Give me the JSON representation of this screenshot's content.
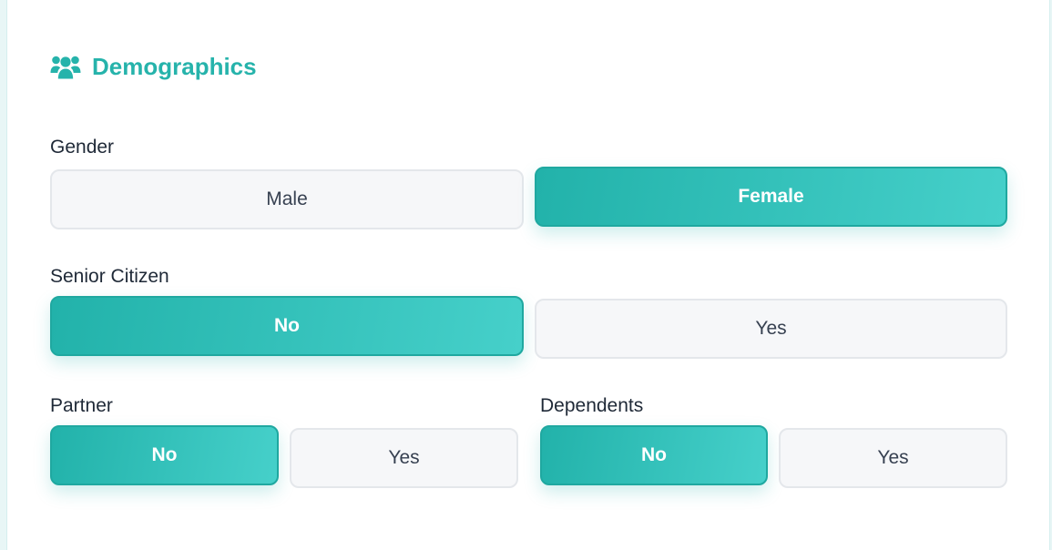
{
  "section": {
    "title": "Demographics",
    "icon": "users-icon",
    "accent_color": "#26b3ab"
  },
  "fields": {
    "gender": {
      "label": "Gender",
      "options": [
        {
          "label": "Male",
          "selected": false
        },
        {
          "label": "Female",
          "selected": true
        }
      ]
    },
    "senior_citizen": {
      "label": "Senior Citizen",
      "options": [
        {
          "label": "No",
          "selected": true
        },
        {
          "label": "Yes",
          "selected": false
        }
      ]
    },
    "partner": {
      "label": "Partner",
      "options": [
        {
          "label": "No",
          "selected": true
        },
        {
          "label": "Yes",
          "selected": false
        }
      ]
    },
    "dependents": {
      "label": "Dependents",
      "options": [
        {
          "label": "No",
          "selected": true
        },
        {
          "label": "Yes",
          "selected": false
        }
      ]
    }
  }
}
